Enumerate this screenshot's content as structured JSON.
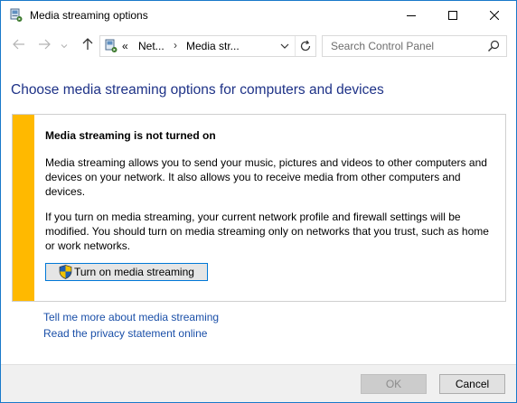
{
  "window": {
    "title": "Media streaming options",
    "icon": "media-streaming-icon",
    "controls": [
      "minimize-icon",
      "maximize-icon",
      "close-icon"
    ]
  },
  "nav": {
    "back_icon": "arrow-left-icon",
    "forward_icon": "arrow-right-icon",
    "recent_icon": "chevron-down-icon",
    "up_icon": "arrow-up-icon"
  },
  "address": {
    "overflow": "«",
    "segments": [
      "Net...",
      "Media str..."
    ],
    "separator": "›",
    "dropdown_icon": "chevron-down-icon",
    "refresh_icon": "refresh-icon"
  },
  "search": {
    "placeholder": "Search Control Panel",
    "value": "",
    "icon": "search-icon"
  },
  "main": {
    "title": "Choose media streaming options for computers and devices",
    "panel": {
      "accent_color": "#ffb900",
      "heading": "Media streaming is not turned on",
      "paragraph1": "Media streaming allows you to send your music, pictures and videos to other computers and devices on your network.  It also allows you to receive media from other computers and devices.",
      "paragraph2": "If you turn on media streaming, your current network profile and firewall settings will be modified.  You should turn on media streaming only on networks that you trust, such as home or work networks.",
      "button_label": "Turn on media streaming",
      "button_icon": "uac-shield-icon"
    },
    "links": [
      "Tell me more about media streaming",
      "Read the privacy statement online"
    ]
  },
  "footer": {
    "ok_label": "OK",
    "ok_enabled": false,
    "cancel_label": "Cancel"
  },
  "colors": {
    "title": "#1e3287",
    "link": "#1a4fa8",
    "window_border": "#1979ca",
    "focus_border": "#0078d7"
  }
}
